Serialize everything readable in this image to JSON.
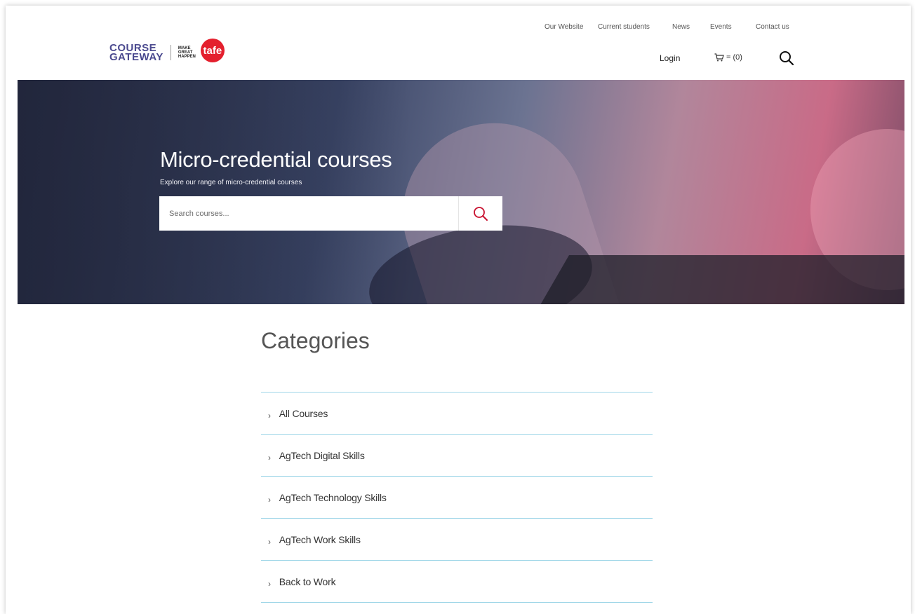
{
  "brand": {
    "course_line1": "COURSE",
    "course_line2": "GATEWAY",
    "mgh_line1": "MAKE",
    "mgh_line2": "GREAT",
    "mgh_line3": "HAPPEN",
    "tafe": "tafe",
    "accent_red": "#e4202e",
    "brand_purple": "#4b4a8f"
  },
  "topnav": {
    "items": [
      "Our Website",
      "Current students",
      "News",
      "Events",
      "Contact us"
    ]
  },
  "mainnav": {
    "login": "Login",
    "cart_label": "= (0)",
    "cart_icon": "cart-icon",
    "search_icon": "search-icon"
  },
  "hero": {
    "title": "Micro-credential courses",
    "subtitle": "Explore our range of micro-credential courses",
    "search_placeholder": "Search courses...",
    "search_icon": "search-icon"
  },
  "categories": {
    "title": "Categories",
    "line_color": "#9fd6e8",
    "items": [
      "All Courses",
      "AgTech Digital Skills",
      "AgTech Technology Skills",
      "AgTech Work Skills",
      "Back to Work"
    ]
  }
}
